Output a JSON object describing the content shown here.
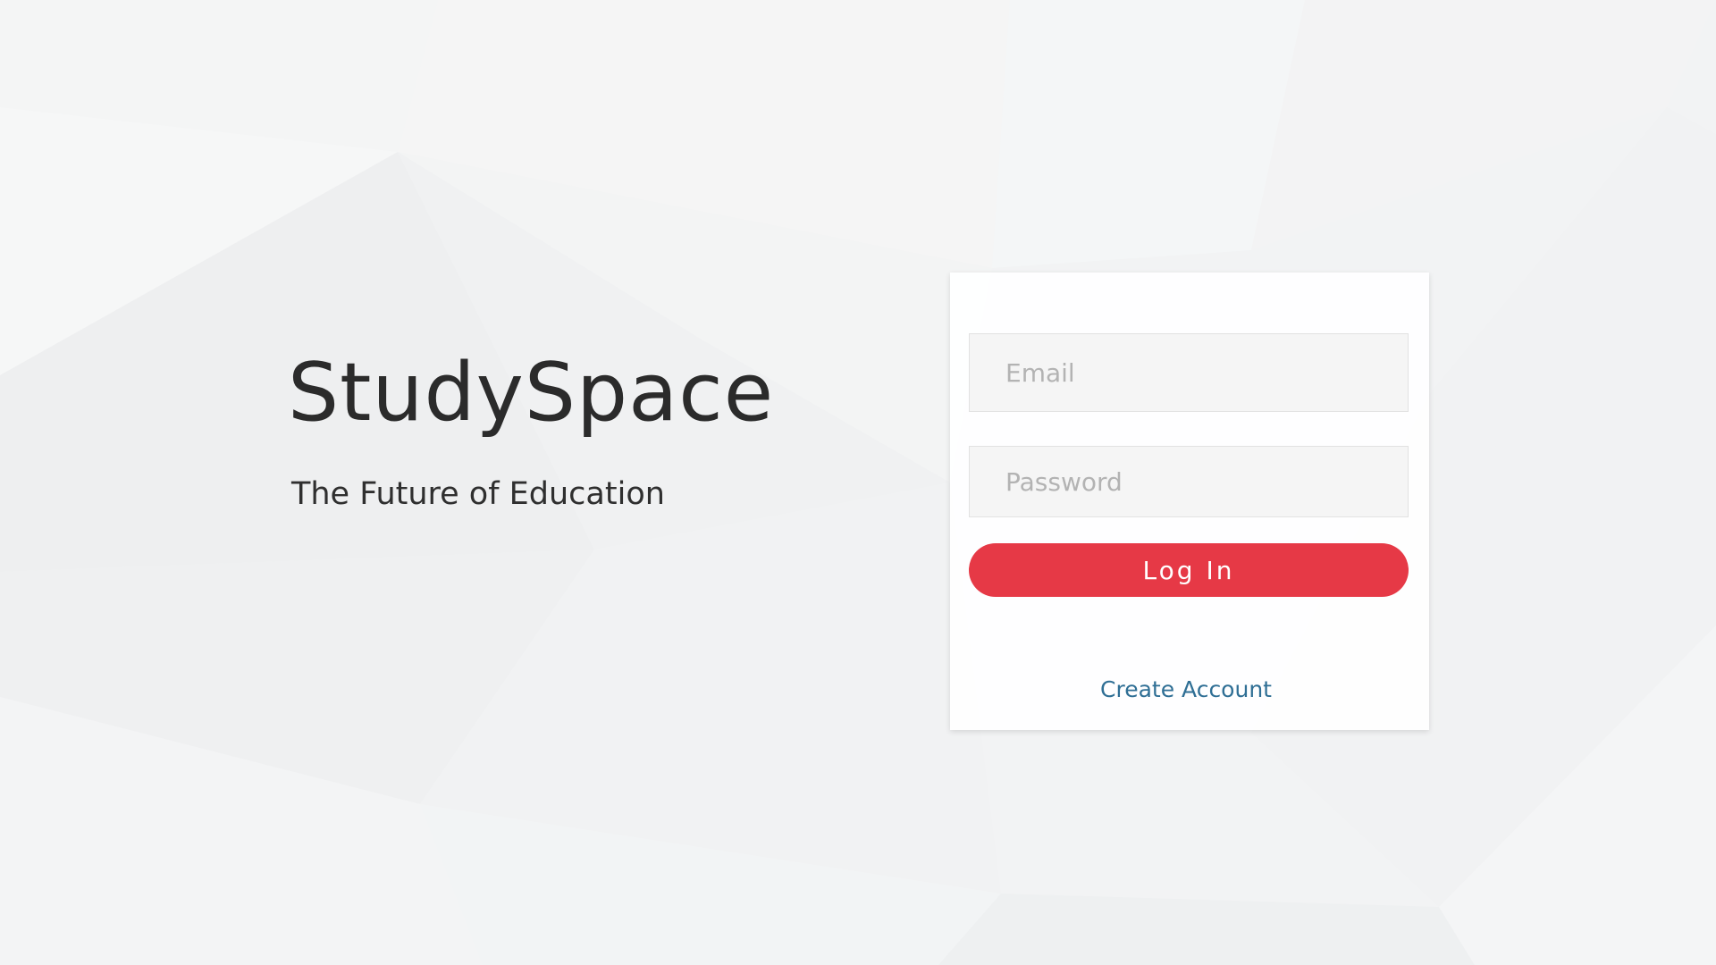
{
  "brand": {
    "title": "StudySpace",
    "tagline": "The Future of Education"
  },
  "login_form": {
    "email_placeholder": "Email",
    "email_value": "",
    "password_placeholder": "Password",
    "password_value": "",
    "login_label": "Log In",
    "create_account_label": "Create Account"
  },
  "colors": {
    "accent": "#e63946",
    "link": "#2f6f95",
    "text": "#2b2b2b",
    "background": "#f2f3f4"
  }
}
